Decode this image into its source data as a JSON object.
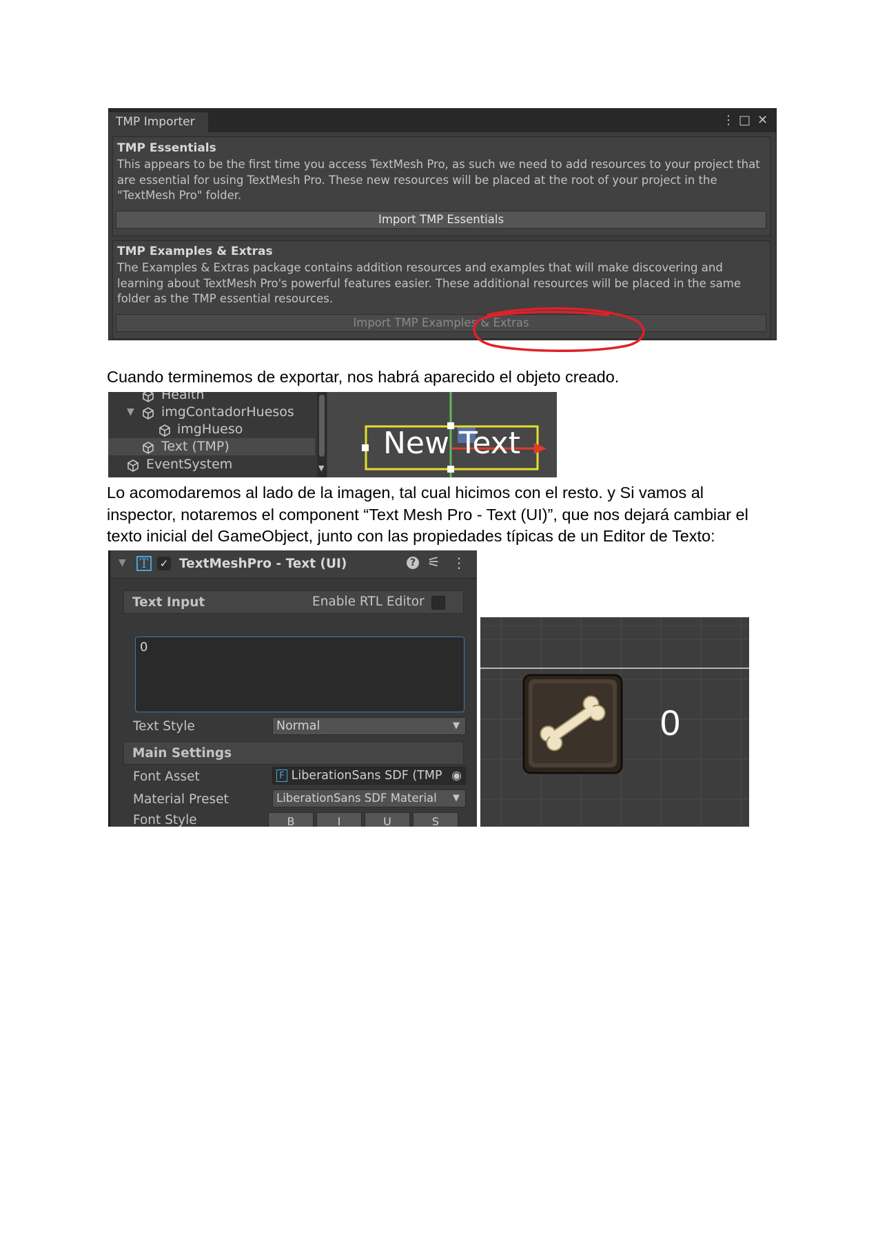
{
  "importer": {
    "tab_title": "TMP Importer",
    "controls": {
      "menu": "⋮",
      "maximize": "□",
      "close": "✕"
    },
    "essentials": {
      "heading": "TMP Essentials",
      "body": "This appears to be the first time you access TextMesh Pro, as such we need to add resources to your project that are essential for using TextMesh Pro. These new resources will be placed at the root of your project in the \"TextMesh Pro\" folder.",
      "button": "Import TMP Essentials"
    },
    "examples": {
      "heading": "TMP Examples & Extras",
      "body": "The Examples & Extras package contains addition resources and examples that will make discovering and learning about TextMesh Pro's powerful features easier. These additional resources will be placed in the same folder as the TMP essential resources.",
      "button": "Import TMP Examples & Extras"
    },
    "highlight_color": "#e0202a"
  },
  "paragraph_1": "Cuando terminemos de exportar, nos habrá aparecido el objeto creado.",
  "hierarchy": {
    "items": [
      {
        "label": "Health"
      },
      {
        "label": "imgContadorHuesos"
      },
      {
        "label": "imgHueso"
      },
      {
        "label": "Text (TMP)"
      },
      {
        "label": "EventSystem"
      }
    ],
    "scene_text": "New Text"
  },
  "paragraph_2": "Lo acomodaremos al lado de la imagen, tal cual hicimos con el resto. y Si vamos al inspector, notaremos el component “Text Mesh Pro - Text (UI)”, que nos dejará cambiar el texto inicial del GameObject, junto con las propiedades típicas de un Editor de Texto:",
  "inspector": {
    "component_title": "TextMeshPro - Text (UI)",
    "icon_letter": "T",
    "text_input_label": "Text Input",
    "rtl_label": "Enable RTL Editor",
    "text_value": "0",
    "text_style_label": "Text Style",
    "text_style_value": "Normal",
    "main_settings_label": "Main Settings",
    "font_asset_label": "Font Asset",
    "font_asset_icon": "F",
    "font_asset_value": "LiberationSans SDF (TMP",
    "material_preset_label": "Material Preset",
    "material_preset_value": "LiberationSans SDF Material",
    "font_style_label": "Font Style",
    "font_style_buttons": [
      "B",
      "I",
      "U",
      "S"
    ],
    "accent_color": "#3a79bb"
  },
  "game_view": {
    "counter_value": "0",
    "icon": "bone-icon"
  }
}
